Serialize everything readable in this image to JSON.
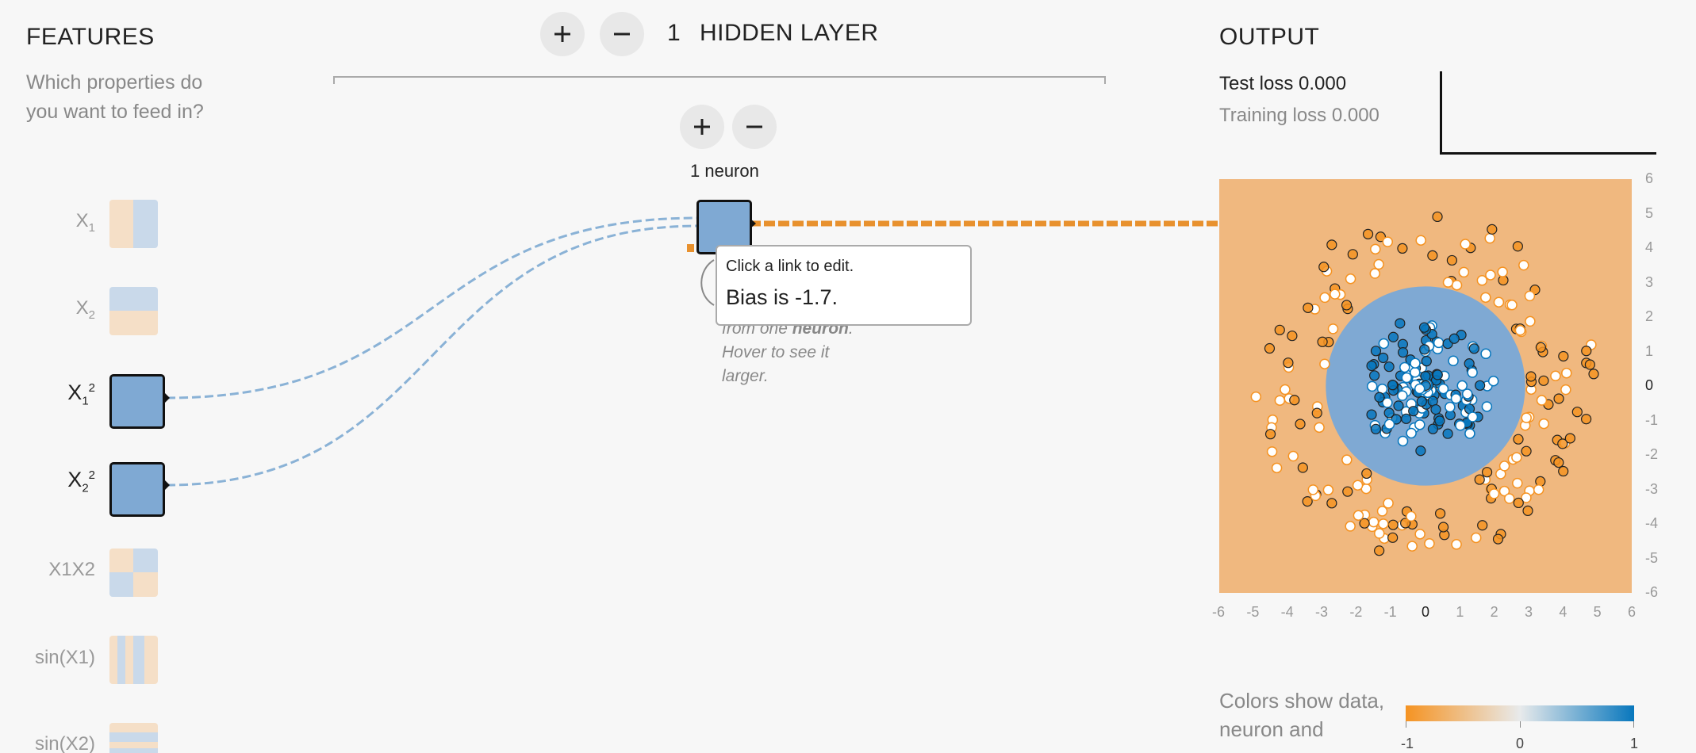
{
  "features": {
    "title": "FEATURES",
    "subtitle_line1": "Which properties do",
    "subtitle_line2": "you want to feed in?",
    "items": [
      {
        "base": "X",
        "sub": "1",
        "sup": "",
        "active": false
      },
      {
        "base": "X",
        "sub": "2",
        "sup": "",
        "active": false
      },
      {
        "base": "X",
        "sub": "1",
        "sup": "2",
        "active": true
      },
      {
        "base": "X",
        "sub": "2",
        "sup": "2",
        "active": true
      },
      {
        "base": "X1X2",
        "sub": "",
        "sup": "",
        "active": false
      },
      {
        "base": "sin(X1)",
        "sub": "",
        "sup": "",
        "active": false
      },
      {
        "base": "sin(X2)",
        "sub": "",
        "sup": "",
        "active": false
      }
    ]
  },
  "hidden_layers": {
    "count": "1",
    "label": "HIDDEN LAYER",
    "neuron_label": "1 neuron"
  },
  "tooltip": {
    "line1": "Click a link to edit.",
    "line2": "Bias is -1.7."
  },
  "note": {
    "line1_prefix": "from one ",
    "line1_bold": "neuron",
    "line1_suffix": ".",
    "line2": "Hover to see it",
    "line3": "larger."
  },
  "output": {
    "title": "OUTPUT",
    "test_loss": "Test loss 0.000",
    "training_loss": "Training loss 0.000",
    "legend_text_line1": "Colors show data,",
    "legend_text_line2": "neuron and",
    "legend_ticks": [
      "-1",
      "0",
      "1"
    ]
  },
  "chart_data": {
    "type": "scatter",
    "title": "",
    "xlabel": "",
    "ylabel": "",
    "xlim": [
      -6,
      6
    ],
    "ylim": [
      -6,
      6
    ],
    "x_ticks": [
      "-6",
      "-5",
      "-4",
      "-3",
      "-2",
      "-1",
      "0",
      "1",
      "2",
      "3",
      "4",
      "5",
      "6"
    ],
    "y_ticks": [
      "6",
      "5",
      "4",
      "3",
      "2",
      "1",
      "0",
      "-1",
      "-2",
      "-3",
      "-4",
      "-5",
      "-6"
    ],
    "decision_region": {
      "center": [
        0,
        0
      ],
      "radius": 2.9
    },
    "series": [
      {
        "class": "inner",
        "r_range": [
          0,
          2.0
        ]
      },
      {
        "class": "outer",
        "r_range": [
          3.0,
          5.0
        ]
      }
    ]
  },
  "colors": {
    "orange": "#f59322",
    "blue": "#0877bd",
    "bg_orange": "#f0b87f",
    "bg_blue": "#7fa9d3",
    "neuron_fill": "#7fa9d3"
  }
}
